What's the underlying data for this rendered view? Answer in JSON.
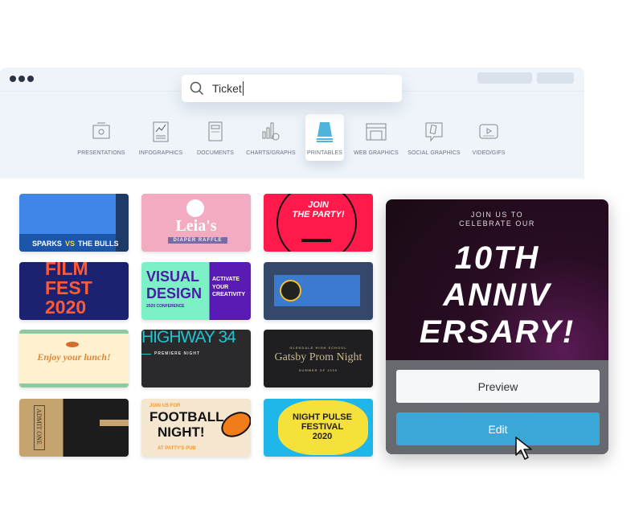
{
  "search": {
    "value": "Ticket"
  },
  "categories": [
    {
      "label": "PRESENTATIONS",
      "icon": "presentation-icon"
    },
    {
      "label": "INFOGRAPHICS",
      "icon": "infographic-icon"
    },
    {
      "label": "DOCUMENTS",
      "icon": "document-icon"
    },
    {
      "label": "CHARTS/GRAPHS",
      "icon": "chart-icon"
    },
    {
      "label": "PRINTABLES",
      "icon": "printable-icon",
      "active": true
    },
    {
      "label": "WEB GRAPHICS",
      "icon": "web-graphic-icon"
    },
    {
      "label": "SOCIAL GRAPHICS",
      "icon": "social-graphic-icon"
    },
    {
      "label": "VIDEO/GIFS",
      "icon": "video-icon"
    }
  ],
  "templates": {
    "sparks": {
      "a": "SPARKS",
      "vs": "VS",
      "b": "THE BULLS"
    },
    "leia": {
      "title": "Leia's",
      "sub": "DIAPER RAFFLE"
    },
    "party": {
      "l1": "JOIN",
      "l2": "THE PARTY!"
    },
    "film": {
      "l1": "FILM",
      "l2": "FEST",
      "l3": "2020"
    },
    "visual": {
      "l1": "VISUAL",
      "l2": "DESIGN",
      "l3": "2020 CONFERENCE",
      "side1": "ACTIVATE",
      "side2": "YOUR CREATIVITY"
    },
    "lunch": {
      "title": "Enjoy your lunch!"
    },
    "highway": {
      "title": "HIGHWAY 34",
      "sub": "PREMIERE NIGHT"
    },
    "gatsby": {
      "top": "GLENDALE HIGH SCHOOL",
      "title": "Gatsby Prom Night",
      "bottom": "SUMMER OF 2020"
    },
    "admit": {
      "title": "ADMIT ONE"
    },
    "football": {
      "top": "JOIN US FOR",
      "l1": "FOOTBALL",
      "l2": "NIGHT!",
      "bottom": "AT PATTY'S PUB"
    },
    "pulse": {
      "l1": "NIGHT PULSE",
      "l2": "FESTIVAL",
      "l3": "2020"
    }
  },
  "featured": {
    "sub1": "JOIN US TO",
    "sub2": "CELEBRATE OUR",
    "l1": "10TH",
    "l2": "ANNIV",
    "l3": "ERSARY!",
    "preview": "Preview",
    "edit": "Edit"
  },
  "colors": {
    "accent": "#3ba7d6",
    "panel": "#eef4fa"
  }
}
